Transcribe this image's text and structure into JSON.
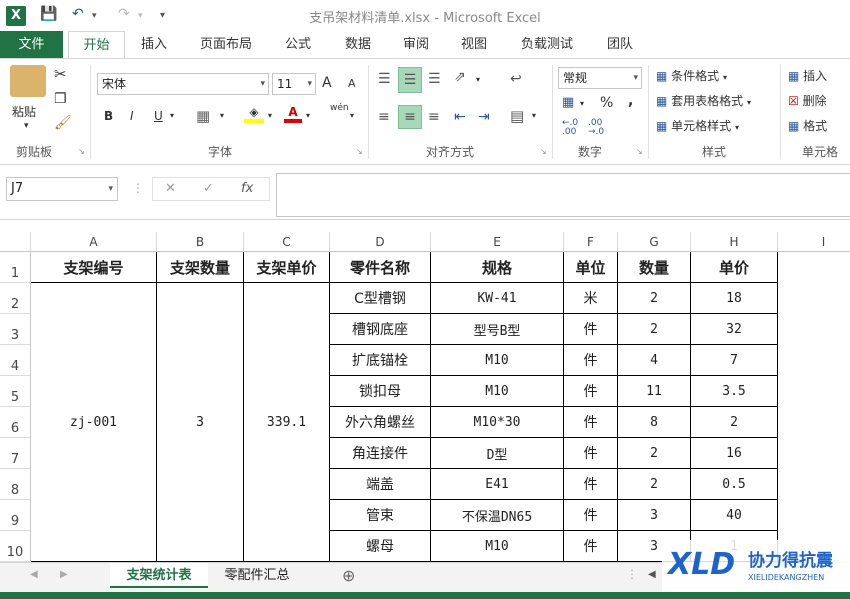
{
  "window": {
    "title": "支吊架材料清单.xlsx - Microsoft Excel",
    "logo": "X"
  },
  "ribbon_tabs": [
    "文件",
    "开始",
    "插入",
    "页面布局",
    "公式",
    "数据",
    "审阅",
    "视图",
    "负载测试",
    "团队"
  ],
  "active_tab": "开始",
  "clipboard": {
    "paste": "粘贴",
    "group": "剪贴板"
  },
  "font": {
    "name": "宋体",
    "size": "11",
    "group": "字体",
    "grow": "A",
    "shrink": "A",
    "bold": "B",
    "italic": "I",
    "underline": "U",
    "phonetic": "wén"
  },
  "alignment": {
    "group": "对齐方式"
  },
  "number": {
    "format": "常规",
    "group": "数字",
    "percent": "%",
    "comma": ",",
    "inc": "←.0\n.00",
    "dec": ".00\n→.0"
  },
  "styles": {
    "conditional": "条件格式",
    "table": "套用表格格式",
    "cell": "单元格样式",
    "group": "样式"
  },
  "cells": {
    "insert": "插入",
    "delete": "删除",
    "format": "格式",
    "group": "单元格"
  },
  "formula_bar": {
    "name_box": "J7",
    "fx": "fx",
    "value": ""
  },
  "columns": [
    "A",
    "B",
    "C",
    "D",
    "E",
    "F",
    "G",
    "H",
    "I"
  ],
  "rows": [
    "1",
    "2",
    "3",
    "4",
    "5",
    "6",
    "7",
    "8",
    "9",
    "10"
  ],
  "header": [
    "支架编号",
    "支架数量",
    "支架单价",
    "零件名称",
    "规格",
    "单位",
    "数量",
    "单价"
  ],
  "merged": {
    "id": "zj-001",
    "qty": "3",
    "price": "339.1"
  },
  "parts": [
    [
      "C型槽钢",
      "KW-41",
      "米",
      "2",
      "18"
    ],
    [
      "槽钢底座",
      "型号B型",
      "件",
      "2",
      "32"
    ],
    [
      "扩底锚栓",
      "M10",
      "件",
      "4",
      "7"
    ],
    [
      "锁扣母",
      "M10",
      "件",
      "11",
      "3.5"
    ],
    [
      "外六角螺丝",
      "M10*30",
      "件",
      "8",
      "2"
    ],
    [
      "角连接件",
      "D型",
      "件",
      "2",
      "16"
    ],
    [
      "端盖",
      "E41",
      "件",
      "2",
      "0.5"
    ],
    [
      "管束",
      "不保温DN65",
      "件",
      "3",
      "40"
    ],
    [
      "螺母",
      "M10",
      "件",
      "3",
      "1"
    ]
  ],
  "sheets": [
    "支架统计表",
    "零配件汇总"
  ],
  "active_sheet": "支架统计表",
  "watermark": {
    "brand": "XLD",
    "cn": "协力得抗震",
    "en": "XIELIDEKANGZHEN"
  },
  "colors": {
    "excel_green": "#217346",
    "accent_blue": "#2b579a"
  }
}
